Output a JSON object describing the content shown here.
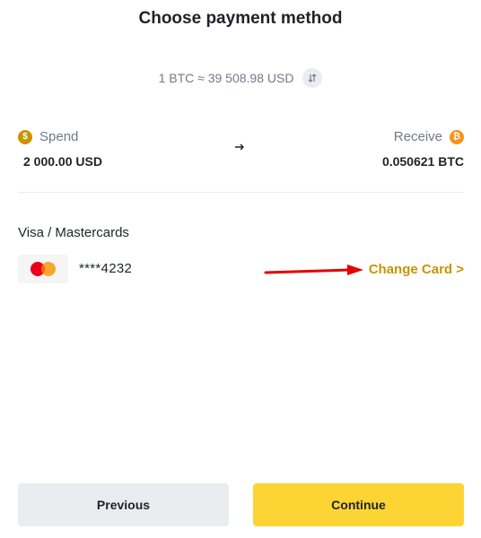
{
  "header": {
    "title": "Choose payment method"
  },
  "rate": {
    "text": "1 BTC ≈ 39 508.98 USD"
  },
  "spend": {
    "label": "Spend",
    "amount": "2 000.00 USD",
    "coin_symbol": "$"
  },
  "receive": {
    "label": "Receive",
    "amount": "0.050621 BTC",
    "coin_symbol": "₿"
  },
  "payment": {
    "section_title": "Visa / Mastercards",
    "card_number": "****4232",
    "change_card_label": "Change Card >"
  },
  "buttons": {
    "previous": "Previous",
    "continue": "Continue"
  },
  "colors": {
    "accent": "#c99400",
    "primary_button": "#fcd535",
    "secondary_button": "#eaecef",
    "annotation_arrow": "#e60000"
  }
}
